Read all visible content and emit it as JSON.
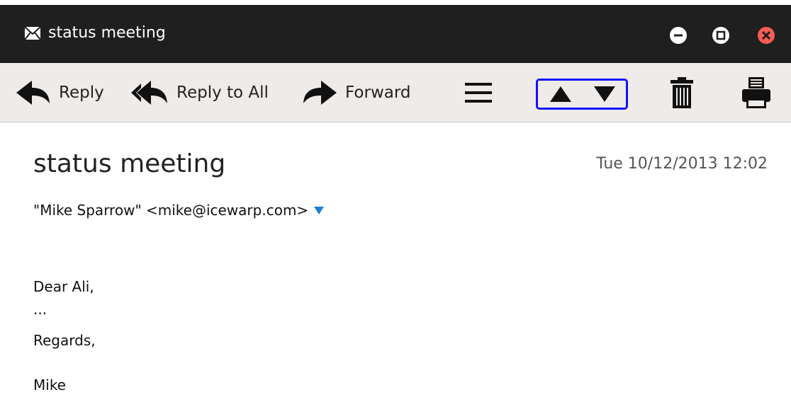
{
  "window": {
    "title": "status meeting",
    "controls": [
      "minimize-icon",
      "maximize-icon",
      "close-icon"
    ],
    "close_color": "#f75d54"
  },
  "toolbar": {
    "reply_label": "Reply",
    "reply_all_label": "Reply to All",
    "forward_label": "Forward",
    "nav_highlight_color": "#1010ff"
  },
  "message": {
    "subject": "status meeting",
    "date": "Tue 10/12/2013 12:02",
    "from": "\"Mike Sparrow\" <mike@icewarp.com>",
    "body": {
      "greeting": "Dear Ali,",
      "ellipsis": "...",
      "closing": "Regards,",
      "signature": "Mike"
    }
  }
}
